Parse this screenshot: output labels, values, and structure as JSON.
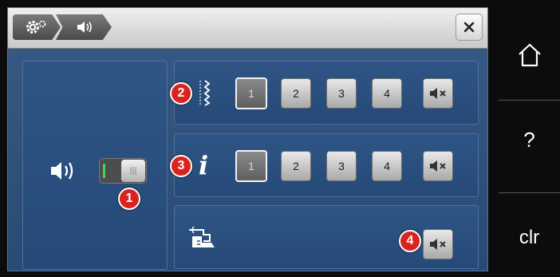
{
  "header": {
    "crumb_settings_icon": "gear-icon",
    "crumb_sound_icon": "speaker-icon",
    "close_icon": "close-icon"
  },
  "left_panel": {
    "speaker_icon": "speaker-icon",
    "switch": {
      "on_mark": "I",
      "off_mark": "III",
      "state": "off"
    }
  },
  "rows": [
    {
      "icon": "stitch-icon",
      "badge": "2",
      "options": [
        "1",
        "2",
        "3",
        "4"
      ],
      "selected": "1",
      "mute_icon": "mute-icon"
    },
    {
      "icon": "info-icon",
      "icon_text": "i",
      "badge": "3",
      "options": [
        "1",
        "2",
        "3",
        "4"
      ],
      "selected": "1",
      "mute_icon": "mute-icon"
    },
    {
      "icon": "presser-foot-sensor-icon",
      "badge": "4",
      "mute_icon": "mute-icon"
    }
  ],
  "left_badge": "1",
  "sidebar": {
    "home_icon": "home-icon",
    "help_label": "?",
    "clr_label": "clr"
  },
  "colors": {
    "badge": "#d9231f",
    "panel": "#2a4a76",
    "switch_on": "#3fd65c"
  }
}
